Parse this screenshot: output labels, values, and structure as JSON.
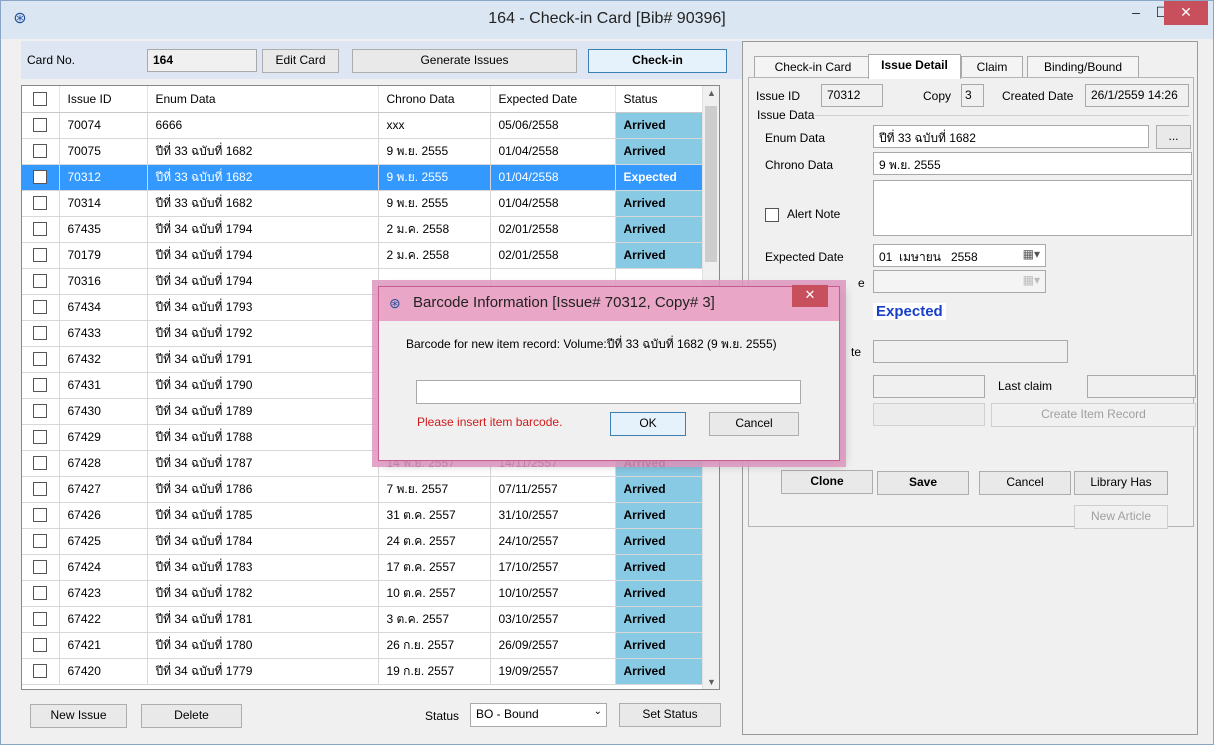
{
  "window": {
    "title": "164 - Check-in Card [Bib# 90396]"
  },
  "toolbar": {
    "card_no_label": "Card No.",
    "card_no_value": "164",
    "edit_card": "Edit Card",
    "generate_issues": "Generate Issues",
    "check_in": "Check-in"
  },
  "grid": {
    "columns": [
      "Issue ID",
      "Enum Data",
      "Chrono Data",
      "Expected Date",
      "Status"
    ],
    "rows": [
      {
        "id": "70074",
        "enum": "6666",
        "chrono": "xxx",
        "date": "05/06/2558",
        "status": "Arrived"
      },
      {
        "id": "70075",
        "enum": "ปีที่ 33 ฉบับที่ 1682",
        "chrono": "9 พ.ย. 2555",
        "date": "01/04/2558",
        "status": "Arrived"
      },
      {
        "id": "70312",
        "enum": "ปีที่ 33 ฉบับที่ 1682",
        "chrono": "9 พ.ย. 2555",
        "date": "01/04/2558",
        "status": "Expected"
      },
      {
        "id": "70314",
        "enum": "ปีที่ 33 ฉบับที่ 1682",
        "chrono": "9 พ.ย. 2555",
        "date": "01/04/2558",
        "status": "Arrived"
      },
      {
        "id": "67435",
        "enum": "ปีที่ 34 ฉบับที่ 1794",
        "chrono": "2 ม.ค. 2558",
        "date": "02/01/2558",
        "status": "Arrived"
      },
      {
        "id": "70179",
        "enum": "ปีที่ 34 ฉบับที่ 1794",
        "chrono": "2 ม.ค. 2558",
        "date": "02/01/2558",
        "status": "Arrived"
      },
      {
        "id": "70316",
        "enum": "ปีที่ 34 ฉบับที่ 1794",
        "chrono": "",
        "date": "",
        "status": ""
      },
      {
        "id": "67434",
        "enum": "ปีที่ 34 ฉบับที่ 1793",
        "chrono": "",
        "date": "",
        "status": ""
      },
      {
        "id": "67433",
        "enum": "ปีที่ 34 ฉบับที่ 1792",
        "chrono": "",
        "date": "",
        "status": ""
      },
      {
        "id": "67432",
        "enum": "ปีที่ 34 ฉบับที่ 1791",
        "chrono": "",
        "date": "",
        "status": ""
      },
      {
        "id": "67431",
        "enum": "ปีที่ 34 ฉบับที่ 1790",
        "chrono": "",
        "date": "",
        "status": ""
      },
      {
        "id": "67430",
        "enum": "ปีที่ 34 ฉบับที่ 1789",
        "chrono": "",
        "date": "",
        "status": ""
      },
      {
        "id": "67429",
        "enum": "ปีที่ 34 ฉบับที่ 1788",
        "chrono": "",
        "date": "",
        "status": ""
      },
      {
        "id": "67428",
        "enum": "ปีที่ 34 ฉบับที่ 1787",
        "chrono": "14 พ.ย. 2557",
        "date": "14/11/2557",
        "status": "Arrived"
      },
      {
        "id": "67427",
        "enum": "ปีที่ 34 ฉบับที่ 1786",
        "chrono": "7 พ.ย. 2557",
        "date": "07/11/2557",
        "status": "Arrived"
      },
      {
        "id": "67426",
        "enum": "ปีที่ 34 ฉบับที่ 1785",
        "chrono": "31 ต.ค. 2557",
        "date": "31/10/2557",
        "status": "Arrived"
      },
      {
        "id": "67425",
        "enum": "ปีที่ 34 ฉบับที่ 1784",
        "chrono": "24 ต.ค. 2557",
        "date": "24/10/2557",
        "status": "Arrived"
      },
      {
        "id": "67424",
        "enum": "ปีที่ 34 ฉบับที่ 1783",
        "chrono": "17 ต.ค. 2557",
        "date": "17/10/2557",
        "status": "Arrived"
      },
      {
        "id": "67423",
        "enum": "ปีที่ 34 ฉบับที่ 1782",
        "chrono": "10 ต.ค. 2557",
        "date": "10/10/2557",
        "status": "Arrived"
      },
      {
        "id": "67422",
        "enum": "ปีที่ 34 ฉบับที่ 1781",
        "chrono": "3 ต.ค. 2557",
        "date": "03/10/2557",
        "status": "Arrived"
      },
      {
        "id": "67421",
        "enum": "ปีที่ 34 ฉบับที่ 1780",
        "chrono": "26 ก.ย. 2557",
        "date": "26/09/2557",
        "status": "Arrived"
      },
      {
        "id": "67420",
        "enum": "ปีที่ 34 ฉบับที่ 1779",
        "chrono": "19 ก.ย. 2557",
        "date": "19/09/2557",
        "status": "Arrived"
      }
    ],
    "selected_row": 2
  },
  "bottom": {
    "new_issue": "New Issue",
    "delete": "Delete",
    "status_label": "Status",
    "status_value": "BO - Bound",
    "set_status": "Set Status"
  },
  "tabs": [
    "Check-in Card",
    "Issue Detail",
    "Claim",
    "Binding/Bound"
  ],
  "active_tab": 1,
  "detail": {
    "issue_id_label": "Issue ID",
    "issue_id": "70312",
    "copy_label": "Copy",
    "copy": "3",
    "created_label": "Created Date",
    "created": "26/1/2559 14:26",
    "group_label": "Issue Data",
    "enum_label": "Enum Data",
    "enum_value": "ปีที่ 33 ฉบับที่ 1682",
    "ellipsis": "...",
    "chrono_label": "Chrono Data",
    "chrono_value": "9 พ.ย. 2555",
    "alert_label": "Alert Note",
    "expected_label": "Expected Date",
    "expected_day": "01",
    "expected_month": "เมษายน",
    "expected_year": "2558",
    "partial_label_e": "e",
    "partial_label_te": "te",
    "status_value": "Expected",
    "last_claim_label": "Last claim",
    "create_item": "Create Item Record",
    "clone": "Clone",
    "save": "Save",
    "cancel": "Cancel",
    "library_has": "Library Has",
    "new_article": "New Article"
  },
  "dialog": {
    "title": "Barcode Information [Issue# 70312, Copy# 3]",
    "message": "Barcode for new item record: Volume:ปีที่ 33 ฉบับที่ 1682 (9 พ.ย. 2555)",
    "input_value": "",
    "error": "Please insert item barcode.",
    "ok": "OK",
    "cancel": "Cancel"
  }
}
